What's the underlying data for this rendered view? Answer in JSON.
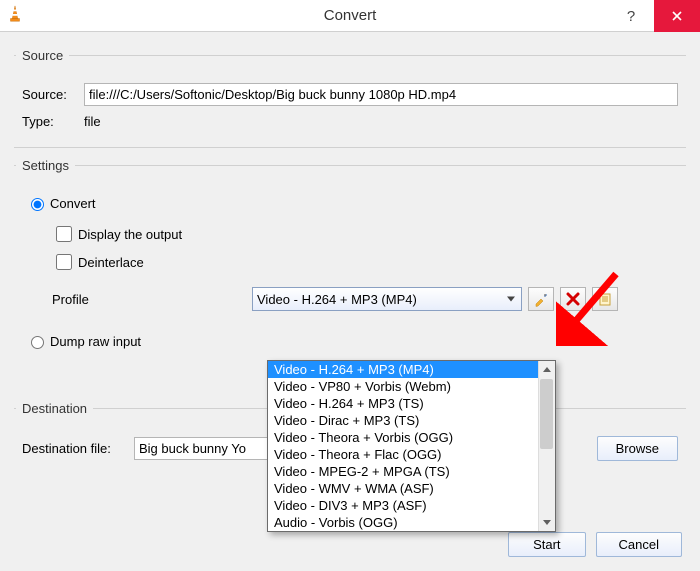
{
  "window": {
    "title": "Convert"
  },
  "source_group": {
    "legend": "Source",
    "source_label": "Source:",
    "source_value": "file:///C:/Users/Softonic/Desktop/Big buck bunny 1080p HD.mp4",
    "type_label": "Type:",
    "type_value": "file"
  },
  "settings_group": {
    "legend": "Settings",
    "convert_label": "Convert",
    "display_output_label": "Display the output",
    "deinterlace_label": "Deinterlace",
    "profile_label": "Profile",
    "profile_selected": "Video - H.264 + MP3 (MP4)",
    "dump_raw_label": "Dump raw input",
    "profile_options": [
      "Video - H.264 + MP3 (MP4)",
      "Video - VP80 + Vorbis (Webm)",
      "Video - H.264 + MP3 (TS)",
      "Video - Dirac + MP3 (TS)",
      "Video - Theora + Vorbis (OGG)",
      "Video - Theora + Flac (OGG)",
      "Video - MPEG-2 + MPGA (TS)",
      "Video - WMV + WMA (ASF)",
      "Video - DIV3 + MP3 (ASF)",
      "Audio - Vorbis (OGG)"
    ]
  },
  "destination_group": {
    "legend": "Destination",
    "dest_label": "Destination file:",
    "dest_value": "Big buck bunny Yo",
    "browse_label": "Browse"
  },
  "buttons": {
    "start": "Start",
    "cancel": "Cancel"
  },
  "icons": {
    "edit": "edit-profile",
    "delete": "delete-profile",
    "new": "new-profile"
  }
}
